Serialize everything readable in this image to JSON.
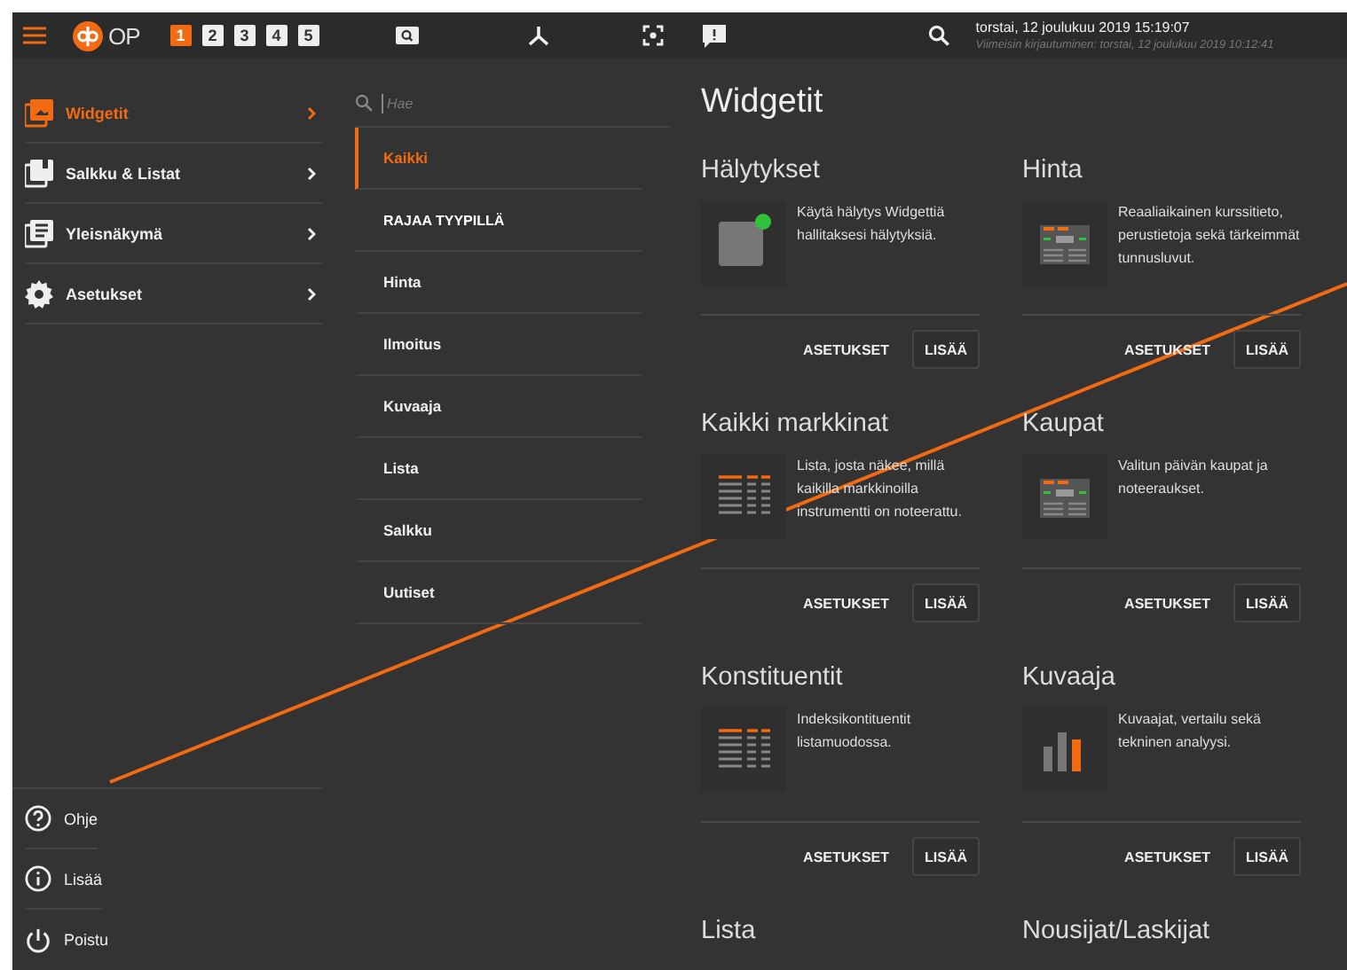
{
  "topbar": {
    "logo_text": "OP",
    "workspaces": [
      {
        "label": "1",
        "selected": true
      },
      {
        "label": "2",
        "selected": false
      },
      {
        "label": "3",
        "selected": false
      },
      {
        "label": "4",
        "selected": false
      },
      {
        "label": "5",
        "selected": false
      }
    ],
    "datetime": "torstai, 12 joulukuu 2019 15:19:07",
    "last_login": "Viimeisin kirjautuminen: torstai, 12 joulukuu 2019 10:12:41"
  },
  "sidebar": {
    "items": [
      {
        "label": "Widgetit",
        "selected": true
      },
      {
        "label": "Salkku & Listat",
        "selected": false
      },
      {
        "label": "Yleisnäkymä",
        "selected": false
      },
      {
        "label": "Asetukset",
        "selected": false
      }
    ],
    "bottom_items": [
      {
        "label": "Ohje"
      },
      {
        "label": "Lisää"
      },
      {
        "label": "Poistu"
      }
    ]
  },
  "submenu": {
    "search": {
      "placeholder": "Hae"
    },
    "items": [
      {
        "kind": "item",
        "label": "Kaikki",
        "selected": true
      },
      {
        "kind": "header",
        "label": "RAJAA TYYPILLÄ"
      },
      {
        "kind": "item",
        "label": "Hinta",
        "selected": false
      },
      {
        "kind": "item",
        "label": "Ilmoitus",
        "selected": false
      },
      {
        "kind": "item",
        "label": "Kuvaaja",
        "selected": false
      },
      {
        "kind": "item",
        "label": "Lista",
        "selected": false
      },
      {
        "kind": "item",
        "label": "Salkku",
        "selected": false
      },
      {
        "kind": "item",
        "label": "Uutiset",
        "selected": false
      }
    ]
  },
  "main": {
    "title": "Widgetit",
    "widgets": [
      {
        "title": "Hälytykset",
        "description": "Käytä hälytys Widgettiä hallitaksesi hälytyksiä.",
        "buttons": [
          "ASETUKSET",
          "LISÄÄ"
        ]
      },
      {
        "title": "Hinta",
        "description": "Reaaliaikainen kurssitieto, perustietoja sekä tärkeimmät tunnusluvut.",
        "buttons": [
          "ASETUKSET",
          "LISÄÄ"
        ]
      },
      {
        "title": "Kaikki markkinat",
        "description": "Lista, josta näkee, millä kaikilla markkinoilla instrumentti on noteerattu.",
        "buttons": [
          "ASETUKSET",
          "LISÄÄ"
        ]
      },
      {
        "title": "Kaupat",
        "description": "Valitun päivän kaupat ja noteeraukset.",
        "buttons": [
          "ASETUKSET",
          "LISÄÄ"
        ]
      },
      {
        "title": "Konstituentit",
        "description": "Indeksikontituentit listamuodossa.",
        "buttons": [
          "ASETUKSET",
          "LISÄÄ"
        ]
      },
      {
        "title": "Kuvaaja",
        "description": "Kuvaajat, vertailu sekä tekninen analyysi.",
        "buttons": [
          "ASETUKSET",
          "LISÄÄ"
        ]
      },
      {
        "title": "Lista"
      },
      {
        "title": "Nousijat/Laskijat"
      }
    ]
  }
}
